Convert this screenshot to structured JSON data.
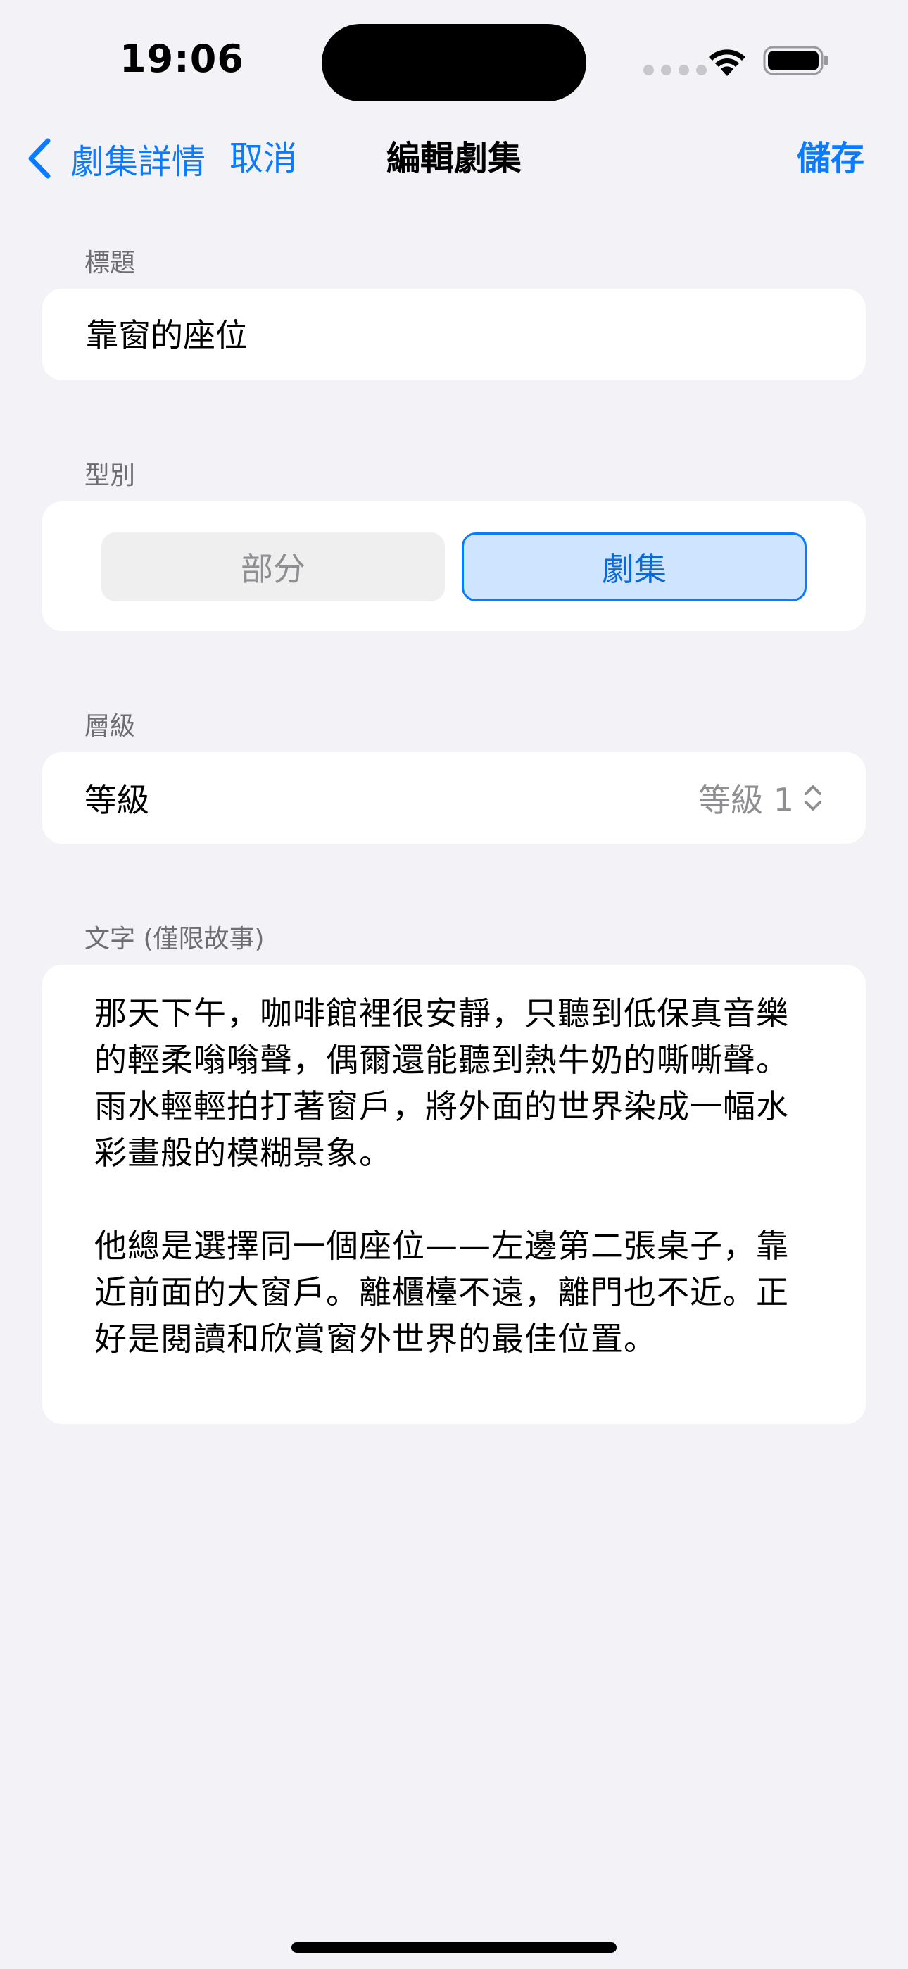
{
  "status_bar": {
    "time": "19:06",
    "icons": [
      "cellular-signal-icon",
      "wifi-icon",
      "battery-icon"
    ]
  },
  "nav": {
    "back_label": "劇集詳情",
    "cancel_label": "取消",
    "title": "編輯劇集",
    "save_label": "儲存"
  },
  "sections": {
    "title": {
      "label": "標題",
      "value": "靠窗的座位"
    },
    "type": {
      "label": "型別",
      "options": [
        "部分",
        "劇集"
      ],
      "selected": "劇集"
    },
    "hierarchy": {
      "label": "層級",
      "row_label": "等級",
      "value": "等級 1"
    },
    "text": {
      "label": "文字 (僅限故事)",
      "content": "那天下午，咖啡館裡很安靜，只聽到低保真音樂的輕柔嗡嗡聲，偶爾還能聽到熱牛奶的嘶嘶聲。雨水輕輕拍打著窗戶，將外面的世界染成一幅水彩畫般的模糊景象。\n\n他總是選擇同一個座位——左邊第二張桌子，靠近前面的大窗戶。離櫃檯不遠，離門也不近。正好是閱讀和欣賞窗外世界的最佳位置。"
    }
  },
  "colors": {
    "accent": "#0a7aff",
    "background": "#f2f2f7",
    "selected_segment_bg": "#cfe5ff",
    "secondary_text": "#8e8e93"
  }
}
